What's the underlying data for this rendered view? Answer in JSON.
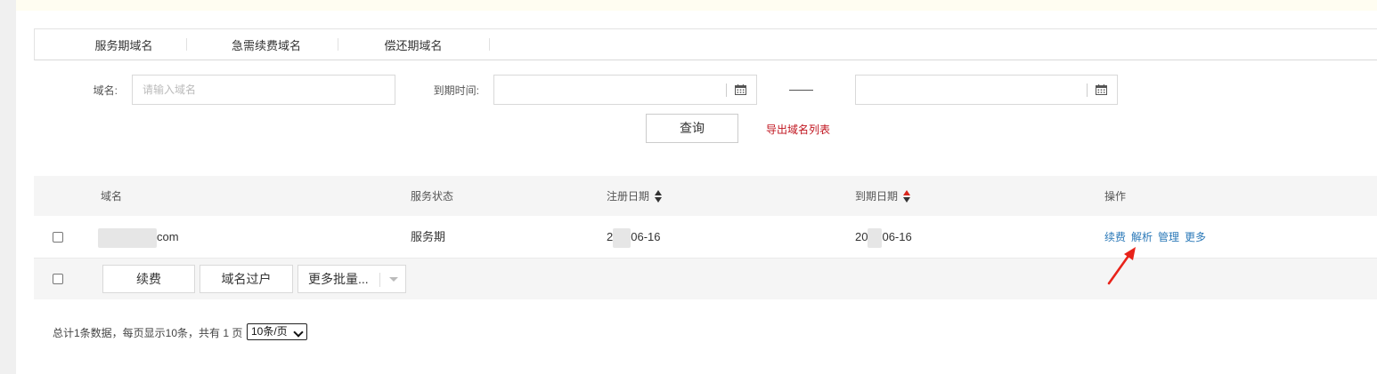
{
  "tabs": [
    "服务期域名",
    "急需续费域名",
    "偿还期域名"
  ],
  "filters": {
    "domain_label": "域名:",
    "domain_placeholder": "请输入域名",
    "expire_label": "到期时间:",
    "query_button": "查询",
    "export_link": "导出域名列表"
  },
  "table": {
    "headers": {
      "domain": "域名",
      "status": "服务状态",
      "reg_date": "注册日期",
      "exp_date": "到期日期",
      "ops": "操作"
    },
    "rows": [
      {
        "domain_suffix": "com",
        "status": "服务期",
        "reg_date_prefix": "2",
        "reg_date_suffix": "06-16",
        "exp_date_prefix": "20",
        "exp_date_suffix": "06-16",
        "ops": [
          "续费",
          "解析",
          "管理",
          "更多"
        ]
      }
    ]
  },
  "batch": {
    "renew": "续费",
    "transfer": "域名过户",
    "more": "更多批量..."
  },
  "pagination": {
    "summary": "总计1条数据，每页显示10条，共有 1 页",
    "page_size": "10条/页"
  },
  "colors": {
    "link": "#2b79b8",
    "export": "#c0151f",
    "sort_active": "#d9261c",
    "annotation_arrow": "#e8231a"
  }
}
